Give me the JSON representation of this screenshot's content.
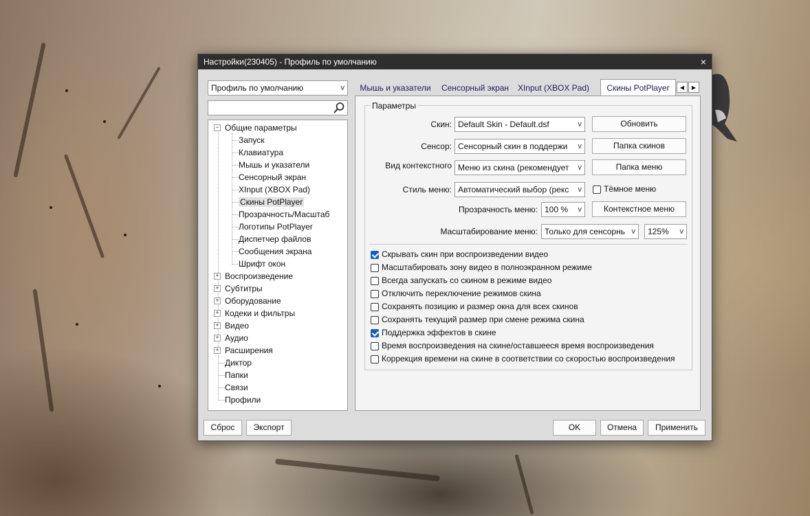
{
  "window": {
    "title": "Настройки(230405) - Профиль по умолчанию",
    "close_glyph": "×"
  },
  "profile_select": {
    "value": "Профиль по умолчанию"
  },
  "search": {
    "value": "",
    "icon": "search-icon"
  },
  "tree": {
    "root_open": "Общие параметры",
    "children": [
      "Запуск",
      "Клавиатура",
      "Мышь и указатели",
      "Сенсорный экран",
      "XInput (XBOX Pad)",
      "Скины PotPlayer",
      "Прозрачность/Масштаб",
      "Логотипы PotPlayer",
      "Диспетчер файлов",
      "Сообщения экрана",
      "Шрифт окон"
    ],
    "collapsed": [
      "Воспроизведение",
      "Субтитры",
      "Оборудование",
      "Кодеки и фильтры",
      "Видео",
      "Аудио",
      "Расширения"
    ],
    "leaves": [
      "Диктор",
      "Папки",
      "Связи",
      "Профили"
    ],
    "selected": "Скины PotPlayer"
  },
  "tabs": [
    "Мышь и указатели",
    "Сенсорный экран",
    "XInput (XBOX Pad)",
    "Скины PotPlayer"
  ],
  "active_tab": "Скины PotPlayer",
  "group_title": "Параметры",
  "form": {
    "skin_label": "Скин:",
    "skin_value": "Default Skin - Default.dsf",
    "refresh_button": "Обновить",
    "sensor_label": "Сенсор:",
    "sensor_value": "Сенсорный скин в поддержи",
    "skins_folder_button": "Папка скинов",
    "context_label": "Вид контекстного",
    "context_value": "Меню из скина (рекомендует",
    "menu_folder_button": "Папка меню",
    "menu_style_label": "Стиль меню:",
    "menu_style_value": "Автоматический выбор (рекс",
    "dark_menu_label": "Тёмное меню",
    "transparency_label": "Прозрачность меню:",
    "transparency_value": "100 %",
    "context_menu_button": "Контекстное меню",
    "scaling_label": "Масштабирование меню:",
    "scaling_value": "Только для сенсорнь",
    "scaling_percent": "125%"
  },
  "options": [
    {
      "label": "Скрывать скин при воспроизведении видео",
      "checked": true
    },
    {
      "label": "Масштабировать зону видео в полноэкранном режиме",
      "checked": false
    },
    {
      "label": "Всегда запускать со скином в режиме видео",
      "checked": false
    },
    {
      "label": "Отключить переключение режимов скина",
      "checked": false
    },
    {
      "label": "Сохранять позицию и размер окна для всех скинов",
      "checked": false
    },
    {
      "label": "Сохранять текущий размер при смене режима скина",
      "checked": false
    },
    {
      "label": "Поддержка эффектов в скине",
      "checked": true
    },
    {
      "label": "Время воспроизведения на скине/оставшееся время воспроизведения",
      "checked": false
    },
    {
      "label": "Коррекция времени на скине в соответствии со скоростью воспроизведения",
      "checked": false
    }
  ],
  "footer": {
    "reset": "Сброс",
    "export": "Экспорт",
    "ok": "OK",
    "cancel": "Отмена",
    "apply": "Применить"
  },
  "glyphs": {
    "dropdown": "v",
    "expand": "+",
    "collapse": "−",
    "left": "◀",
    "right": "▶"
  },
  "colors": {
    "titlebar": "#2e2e2e",
    "checkbox_on": "#1a5fb4",
    "tab_text": "#1c1c5e"
  }
}
